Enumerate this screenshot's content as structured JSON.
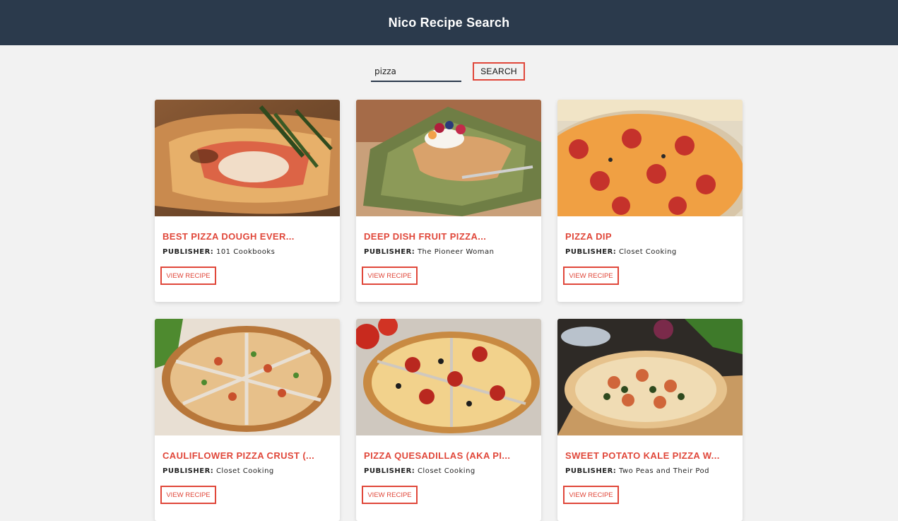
{
  "header": {
    "title": "Nico Recipe Search"
  },
  "search": {
    "value": "pizza",
    "button_label": "SEARCH"
  },
  "cards": [
    {
      "title": "BEST PIZZA DOUGH EVER...",
      "publisher_label": "PUBLISHER:",
      "publisher": "101 Cookbooks",
      "button_label": "VIEW RECIPE",
      "image": "pizza-dough-photo"
    },
    {
      "title": "DEEP DISH FRUIT PIZZA...",
      "publisher_label": "PUBLISHER:",
      "publisher": "The Pioneer Woman",
      "button_label": "VIEW RECIPE",
      "image": "fruit-pizza-photo"
    },
    {
      "title": "PIZZA DIP",
      "publisher_label": "PUBLISHER:",
      "publisher": "Closet Cooking",
      "button_label": "VIEW RECIPE",
      "image": "pizza-dip-photo"
    },
    {
      "title": "CAULIFLOWER PIZZA CRUST (...",
      "publisher_label": "PUBLISHER:",
      "publisher": "Closet Cooking",
      "button_label": "VIEW RECIPE",
      "image": "cauliflower-pizza-photo"
    },
    {
      "title": "PIZZA QUESADILLAS (AKA PI...",
      "publisher_label": "PUBLISHER:",
      "publisher": "Closet Cooking",
      "button_label": "VIEW RECIPE",
      "image": "pizza-quesadilla-photo"
    },
    {
      "title": "SWEET POTATO KALE PIZZA W...",
      "publisher_label": "PUBLISHER:",
      "publisher": "Two Peas and Their Pod",
      "button_label": "VIEW RECIPE",
      "image": "sweet-potato-pizza-photo"
    }
  ],
  "colors": {
    "header_bg": "#2b3a4c",
    "accent": "#e0473a",
    "page_bg": "#f2f2f2"
  }
}
